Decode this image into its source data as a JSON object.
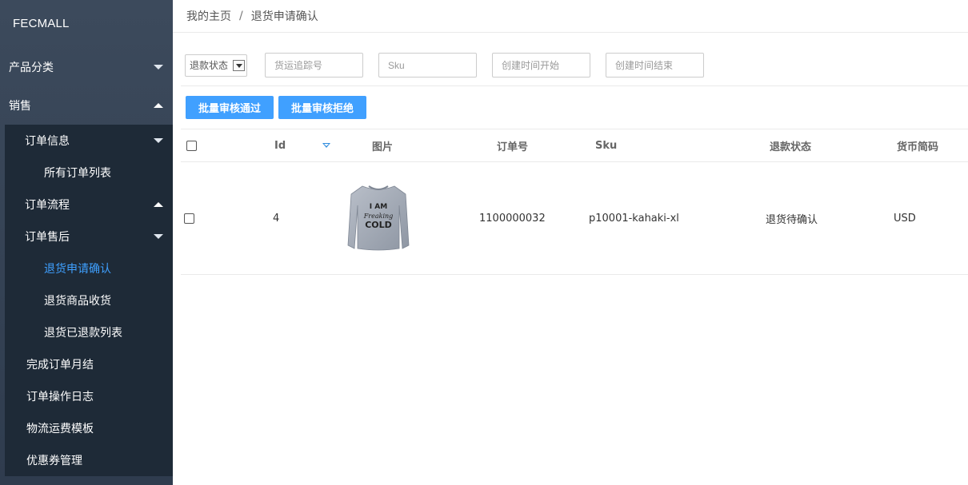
{
  "app": {
    "logo": "FECMALL"
  },
  "sidebar": {
    "product_category": "产品分类",
    "sales": "销售",
    "order_info": "订单信息",
    "all_orders": "所有订单列表",
    "order_flow": "订单流程",
    "after_sales": "订单售后",
    "return_confirm": "退货申请确认",
    "return_receive": "退货商品收货",
    "return_refunded": "退货已退款列表",
    "monthly_close": "完成订单月结",
    "order_log": "订单操作日志",
    "shipping_template": "物流运费模板",
    "coupons": "优惠券管理"
  },
  "breadcrumb": {
    "home": "我的主页",
    "separator": "/",
    "current": "退货申请确认"
  },
  "filters": {
    "refund_status": "退款状态",
    "tracking_placeholder": "货运追踪号",
    "sku_placeholder": "Sku",
    "created_start_placeholder": "创建时间开始",
    "created_end_placeholder": "创建时间结束"
  },
  "actions": {
    "approve": "批量审核通过",
    "reject": "批量审核拒绝"
  },
  "table": {
    "headers": {
      "id": "Id",
      "image": "图片",
      "order_no": "订单号",
      "sku": "Sku",
      "refund_status": "退款状态",
      "currency": "货币简码"
    },
    "rows": [
      {
        "id": "4",
        "image_text_1": "I AM",
        "image_text_2": "Freaking",
        "image_text_3": "COLD",
        "order_no": "1100000032",
        "sku": "p10001-kahaki-xl",
        "refund_status": "退货待确认",
        "currency": "USD"
      }
    ]
  },
  "colors": {
    "sidebar_bg": "#3c4a5c",
    "submenu_bg": "#1e2a37",
    "accent": "#40a0ff",
    "active_link": "#3fa0ff"
  },
  "icons": {
    "dropdown": "caret-down-icon",
    "collapse": "caret-up-icon",
    "sort": "sort-desc-icon",
    "product": "sweater-image"
  }
}
